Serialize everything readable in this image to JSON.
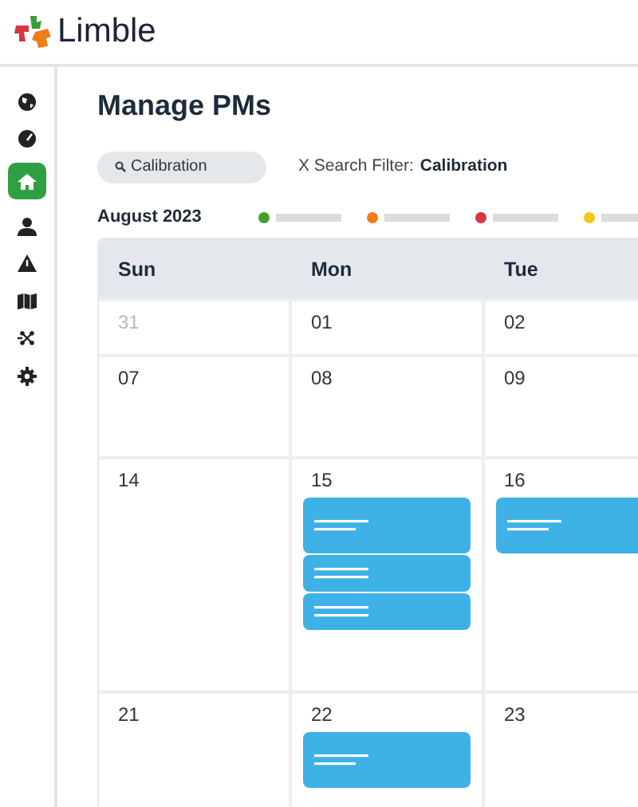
{
  "brand": {
    "name": "Limble"
  },
  "sidebar": {
    "items": [
      {
        "selected": false
      },
      {
        "selected": false
      },
      {
        "selected": true
      },
      {
        "selected": false
      },
      {
        "selected": false
      },
      {
        "selected": false
      },
      {
        "selected": false
      },
      {
        "selected": false
      }
    ]
  },
  "page": {
    "title": "Manage PMs"
  },
  "search": {
    "value": "Calibration"
  },
  "filter": {
    "clear": "X Search Filter:",
    "term": "Calibration"
  },
  "calendar": {
    "month": "August 2023",
    "legend": [
      {
        "color": "#43a02f"
      },
      {
        "color": "#f07d1a"
      },
      {
        "color": "#d9343f"
      },
      {
        "color": "#f5c518"
      }
    ],
    "weekdays": [
      "Sun",
      "Mon",
      "Tue"
    ],
    "weeks": [
      {
        "days": [
          {
            "label": "31",
            "muted": true
          },
          {
            "label": "01",
            "muted": false
          },
          {
            "label": "02",
            "muted": false
          }
        ]
      },
      {
        "days": [
          {
            "label": "07",
            "muted": false
          },
          {
            "label": "08",
            "muted": false
          },
          {
            "label": "09",
            "muted": false
          }
        ]
      },
      {
        "days": [
          {
            "label": "14",
            "muted": false
          },
          {
            "label": "15",
            "muted": false,
            "events": [
              {
                "kind": "tall"
              },
              {
                "kind": "compact"
              },
              {
                "kind": "compact"
              }
            ]
          },
          {
            "label": "16",
            "muted": false,
            "events": [
              {
                "kind": "tall"
              }
            ]
          }
        ]
      },
      {
        "days": [
          {
            "label": "21",
            "muted": false
          },
          {
            "label": "22",
            "muted": false,
            "events": [
              {
                "kind": "tall"
              }
            ]
          },
          {
            "label": "23",
            "muted": false
          }
        ]
      }
    ]
  }
}
